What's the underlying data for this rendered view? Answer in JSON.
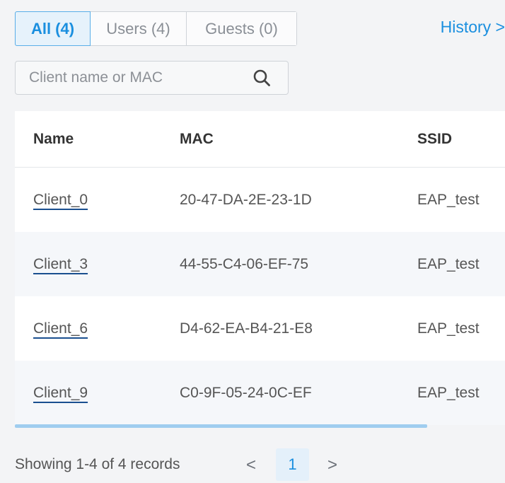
{
  "tabs": {
    "all": "All (4)",
    "users": "Users (4)",
    "guests": "Guests (0)"
  },
  "history_link": "History >",
  "search": {
    "placeholder": "Client name or MAC",
    "icon": "search-icon"
  },
  "table": {
    "headers": {
      "name": "Name",
      "mac": "MAC",
      "ssid": "SSID"
    },
    "rows": [
      {
        "name": "Client_0",
        "mac": "20-47-DA-2E-23-1D",
        "ssid": "EAP_test"
      },
      {
        "name": "Client_3",
        "mac": "44-55-C4-06-EF-75",
        "ssid": "EAP_test"
      },
      {
        "name": "Client_6",
        "mac": "D4-62-EA-B4-21-E8",
        "ssid": "EAP_test"
      },
      {
        "name": "Client_9",
        "mac": "C0-9F-05-24-0C-EF",
        "ssid": "EAP_test"
      }
    ]
  },
  "footer": {
    "records": "Showing 1-4 of 4 records",
    "prev": "<",
    "page": "1",
    "next": ">"
  },
  "colors": {
    "accent": "#1a8fdf",
    "active_tab_bg": "#e6f2fb",
    "scrollbar": "#9fcdef"
  }
}
